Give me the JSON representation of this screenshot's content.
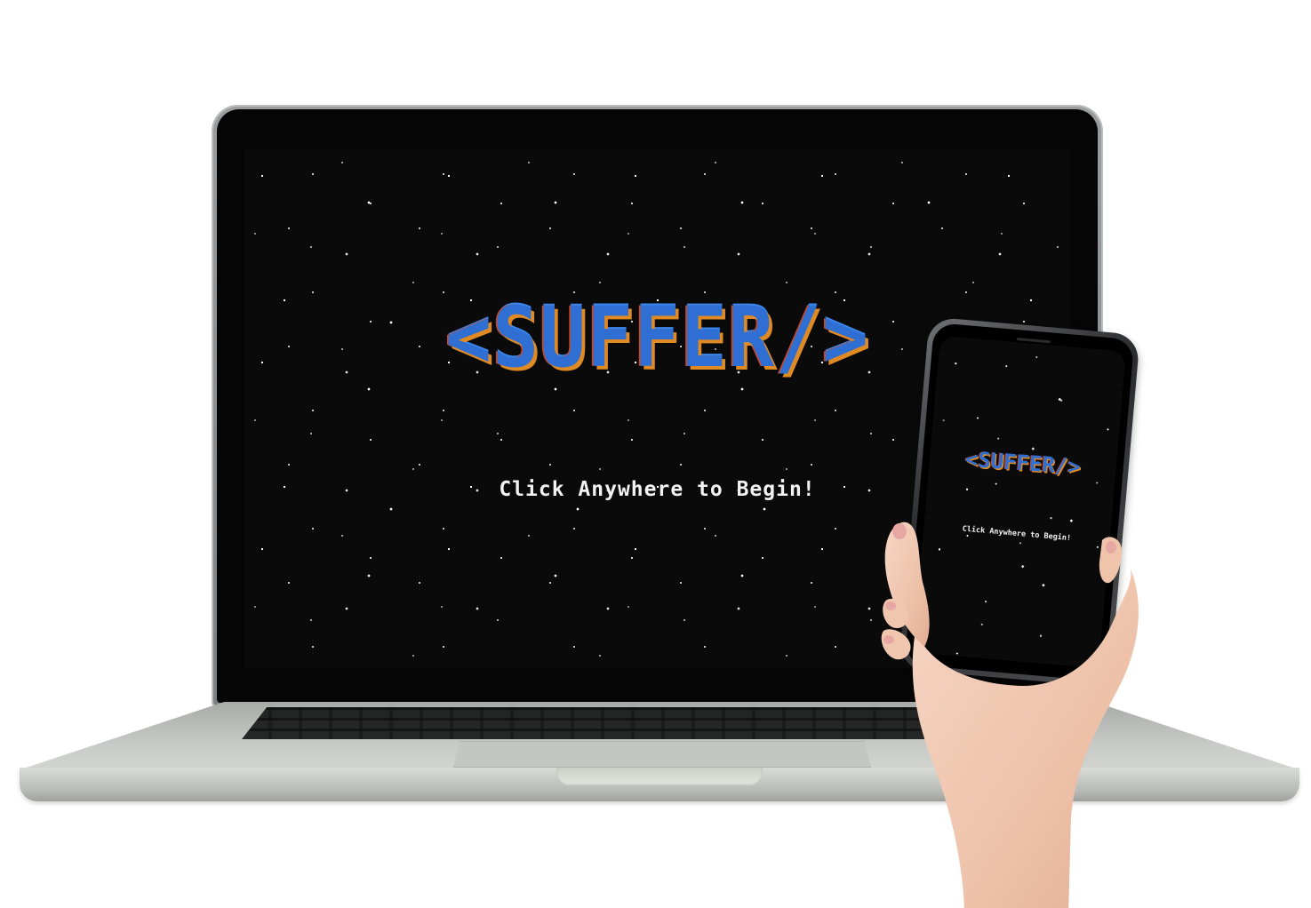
{
  "scene": {
    "description_colors": {
      "space_background": "#0a0a0a",
      "logo_blue": "#2f6fd3",
      "logo_orange": "#e08a23",
      "logo_red": "#c24a2c",
      "prompt_white": "#f2f2f2",
      "skin": "#f3cdb8"
    }
  },
  "laptop": {
    "logo_text": "<SUFFER/>",
    "prompt_text": "Click Anywhere to Begin!"
  },
  "phone": {
    "logo_text": "<SUFFER/>",
    "prompt_text": "Click Anywhere to Begin!"
  }
}
